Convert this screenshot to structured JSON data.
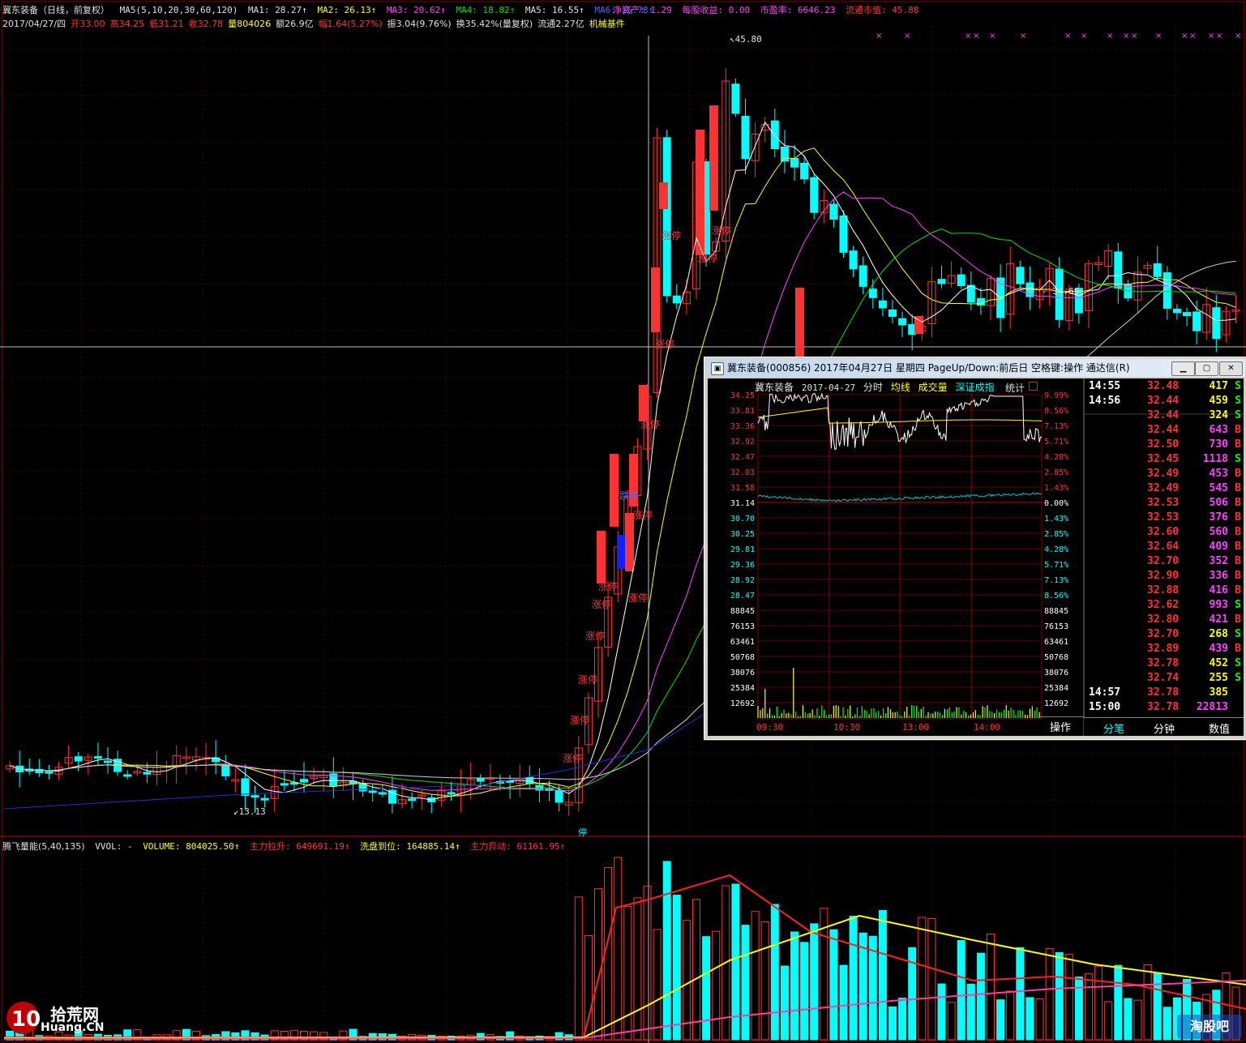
{
  "header": {
    "line1": {
      "title": "冀东装备（日线，前复权）",
      "ma_params": "MA5(5,10,20,30,60,120)",
      "ma1": "MA1: 28.27↑",
      "ma2": "MA2: 26.13↑",
      "ma3": "MA3: 20.62↑",
      "ma4": "MA4: 18.82↑",
      "ma5": "MA5: 16.55↑",
      "ma6": "MA6: 15.78↑",
      "net_asset": "净资产: 1.29",
      "eps": "每股收益: 0.00",
      "pe": "市盈率: 6646.23",
      "float_mv": "流通市值: 45.88"
    },
    "line2": {
      "date": "2017/04/27/四",
      "open": "开33.00",
      "high": "高34.25",
      "low": "低31.21",
      "close": "收32.78",
      "vol": "量804026",
      "amount": "额26.9亿",
      "change": "幅1.64(5.27%)",
      "amplitude": "振3.04(9.76%)",
      "turnover": "换35.42%(量复权)",
      "float_share": "流通2.27亿",
      "sector": "机械基件"
    }
  },
  "main_chart_labels": {
    "high_mark": "45.80",
    "low_mark": "13.13",
    "price_mark": "34.69",
    "limit_up": "涨停",
    "limit_down": "跌停",
    "suspend": "停"
  },
  "volume_header": {
    "name": "腾飞量能(5,40,135)",
    "vvol": "VVOL: -",
    "volume": "VOLUME: 804025.50↑",
    "main_up": "主力拉升: 649691.19↑",
    "wash": "洗盘到位: 164885.14↑",
    "main_move": "主力异动: 61161.95↑"
  },
  "popup": {
    "title": "冀东装备(000856) 2017年04月27日 星期四 PageUp/Down:前后日 空格键:操作 通达信(R)",
    "app_icon": "window-icon",
    "sub_header": {
      "name": "冀东装备",
      "date": "2017-04-27",
      "fenshi": "分时",
      "avg": "均线",
      "volume": "成交量",
      "index": "深证成指",
      "stats": "统计"
    },
    "price_ticks": [
      "34.25",
      "33.81",
      "33.36",
      "32.92",
      "32.47",
      "32.03",
      "31.58",
      "31.14",
      "30.70",
      "30.25",
      "29.81",
      "29.36",
      "28.92",
      "28.47"
    ],
    "pct_ticks": [
      "9.99%",
      "8.56%",
      "7.13%",
      "5.71%",
      "4.28%",
      "2.85%",
      "1.43%",
      "0.00%",
      "1.43%",
      "2.85%",
      "4.28%",
      "5.71%",
      "7.13%",
      "8.56%"
    ],
    "vol_ticks": [
      "88845",
      "76153",
      "63461",
      "50768",
      "38076",
      "25384",
      "12692"
    ],
    "time_ticks": [
      "09:30",
      "10:30",
      "13:00",
      "14:00"
    ],
    "action_label": "操作",
    "ticks": [
      {
        "t": "14:55",
        "p": "32.48",
        "v": "417",
        "bs": "S"
      },
      {
        "t": "14:56",
        "p": "32.44",
        "v": "459",
        "bs": "S"
      },
      {
        "t": "",
        "p": "32.44",
        "v": "324",
        "bs": "S"
      },
      {
        "t": "",
        "p": "32.44",
        "v": "643",
        "bs": "B"
      },
      {
        "t": "",
        "p": "32.50",
        "v": "730",
        "bs": "B"
      },
      {
        "t": "",
        "p": "32.45",
        "v": "1118",
        "bs": "S"
      },
      {
        "t": "",
        "p": "32.49",
        "v": "453",
        "bs": "B"
      },
      {
        "t": "",
        "p": "32.49",
        "v": "545",
        "bs": "B"
      },
      {
        "t": "",
        "p": "32.53",
        "v": "506",
        "bs": "B"
      },
      {
        "t": "",
        "p": "32.53",
        "v": "376",
        "bs": "B"
      },
      {
        "t": "",
        "p": "32.60",
        "v": "560",
        "bs": "B"
      },
      {
        "t": "",
        "p": "32.64",
        "v": "409",
        "bs": "B"
      },
      {
        "t": "",
        "p": "32.70",
        "v": "352",
        "bs": "B"
      },
      {
        "t": "",
        "p": "32.90",
        "v": "336",
        "bs": "B"
      },
      {
        "t": "",
        "p": "32.88",
        "v": "416",
        "bs": "B"
      },
      {
        "t": "",
        "p": "32.62",
        "v": "993",
        "bs": "S"
      },
      {
        "t": "",
        "p": "32.80",
        "v": "421",
        "bs": "B"
      },
      {
        "t": "",
        "p": "32.70",
        "v": "268",
        "bs": "S"
      },
      {
        "t": "",
        "p": "32.89",
        "v": "439",
        "bs": "B"
      },
      {
        "t": "",
        "p": "32.78",
        "v": "452",
        "bs": "S"
      },
      {
        "t": "",
        "p": "32.74",
        "v": "255",
        "bs": "S"
      },
      {
        "t": "14:57",
        "p": "32.78",
        "v": "385",
        "bs": ""
      },
      {
        "t": "15:00",
        "p": "32.78",
        "v": "22813",
        "bs": ""
      }
    ],
    "tabs": [
      "分笔",
      "分钟",
      "数值"
    ]
  },
  "watermarks": {
    "left_text": "拾荒网",
    "left_sub": "Huang.CN",
    "right_text": "淘股吧"
  },
  "colors": {
    "up": "#ff3232",
    "down": "#00ffff",
    "limit_down_fill": "#1020ff",
    "ma_white": "#ffffff",
    "ma_yellow": "#ffff00",
    "ma_magenta": "#ff40ff",
    "ma_green": "#00e000",
    "ma_blue": "#2030d0",
    "grid": "#800000"
  }
}
